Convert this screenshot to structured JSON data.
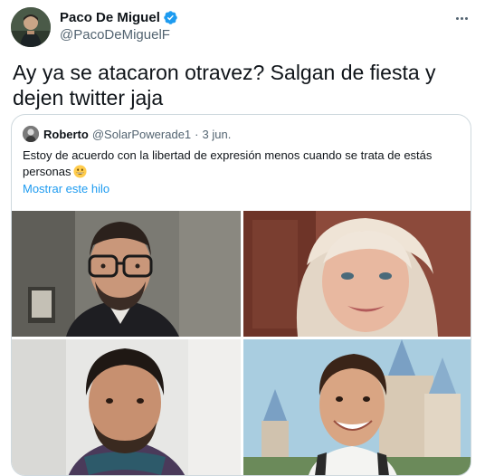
{
  "tweet": {
    "author_name": "Paco De Miguel",
    "author_handle": "@PacoDeMiguelF",
    "verified": true,
    "text": "Ay ya se atacaron otravez? Salgan de fiesta y dejen twitter jaja",
    "more_icon": "more-horizontal-icon"
  },
  "quote": {
    "author_name": "Roberto",
    "author_handle": "@SolarPowerade1",
    "separator": "·",
    "date": "3 jun.",
    "text": "Estoy de acuerdo con la libertad de expresión menos cuando se trata de estás personas",
    "emoji": "grinning-face-emoji",
    "show_thread": "Mostrar este hilo",
    "photos": [
      {
        "description": "man with glasses"
      },
      {
        "description": "blonde woman"
      },
      {
        "description": "man with dark hair"
      },
      {
        "description": "smiling man at castle"
      }
    ]
  },
  "colors": {
    "text_primary": "#0f1419",
    "text_secondary": "#536471",
    "link": "#1d9bf0",
    "border": "#cfd9de",
    "verified": "#1d9bf0"
  }
}
